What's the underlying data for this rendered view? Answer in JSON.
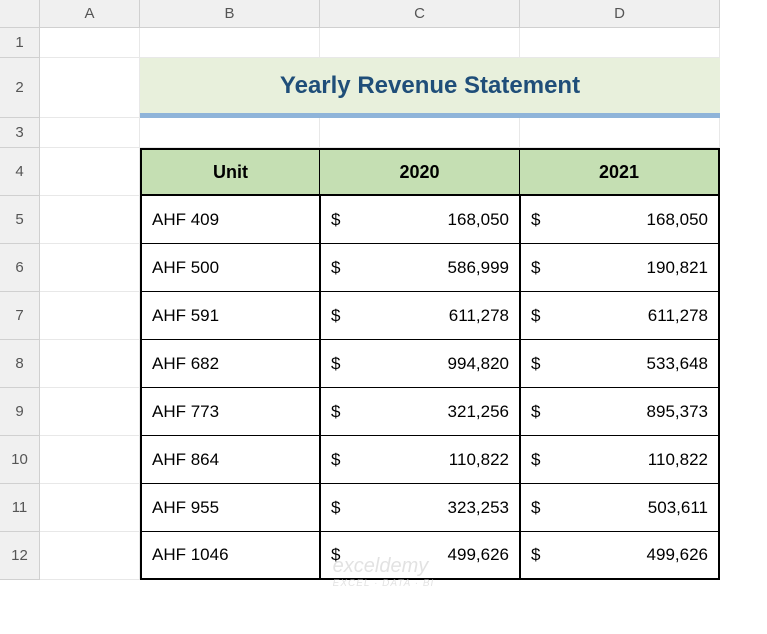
{
  "columns": [
    "A",
    "B",
    "C",
    "D"
  ],
  "rows": [
    "1",
    "2",
    "3",
    "4",
    "5",
    "6",
    "7",
    "8",
    "9",
    "10",
    "11",
    "12"
  ],
  "title": "Yearly Revenue Statement",
  "headers": {
    "unit": "Unit",
    "y2020": "2020",
    "y2021": "2021"
  },
  "data": [
    {
      "unit": "AHF 409",
      "y2020": "168,050",
      "y2021": "168,050"
    },
    {
      "unit": "AHF 500",
      "y2020": "586,999",
      "y2021": "190,821"
    },
    {
      "unit": "AHF 591",
      "y2020": "611,278",
      "y2021": "611,278"
    },
    {
      "unit": "AHF 682",
      "y2020": "994,820",
      "y2021": "533,648"
    },
    {
      "unit": "AHF 773",
      "y2020": "321,256",
      "y2021": "895,373"
    },
    {
      "unit": "AHF 864",
      "y2020": "110,822",
      "y2021": "110,822"
    },
    {
      "unit": "AHF 955",
      "y2020": "323,253",
      "y2021": "503,611"
    },
    {
      "unit": "AHF 1046",
      "y2020": "499,626",
      "y2021": "499,626"
    }
  ],
  "currency": "$",
  "watermark": {
    "main": "exceldemy",
    "sub": "EXCEL · DATA · BI"
  },
  "chart_data": {
    "type": "table",
    "title": "Yearly Revenue Statement",
    "categories": [
      "AHF 409",
      "AHF 500",
      "AHF 591",
      "AHF 682",
      "AHF 773",
      "AHF 864",
      "AHF 955",
      "AHF 1046"
    ],
    "series": [
      {
        "name": "2020",
        "values": [
          168050,
          586999,
          611278,
          994820,
          321256,
          110822,
          323253,
          499626
        ]
      },
      {
        "name": "2021",
        "values": [
          168050,
          190821,
          611278,
          533648,
          895373,
          110822,
          503611,
          499626
        ]
      }
    ]
  }
}
